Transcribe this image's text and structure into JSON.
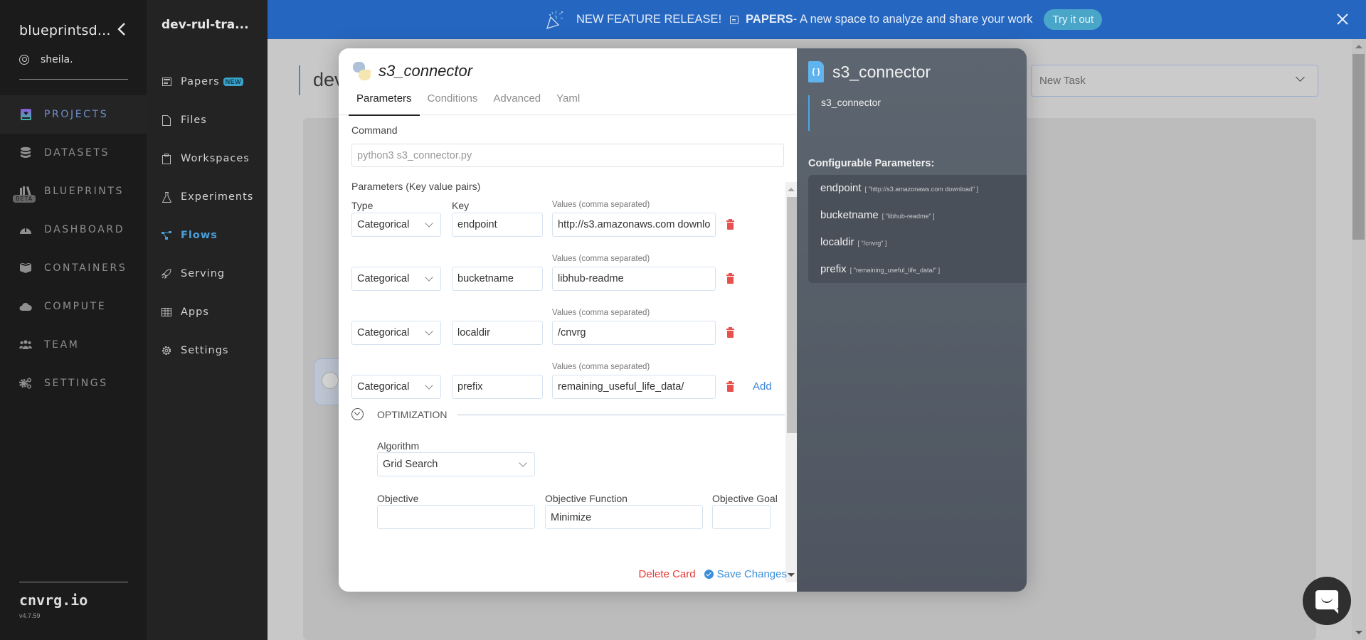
{
  "sidebar": {
    "org_name": "blueprintsd...",
    "user_name": "sheila.",
    "items": [
      {
        "label": "PROJECTS",
        "icon": "projects-icon",
        "active": true
      },
      {
        "label": "DATASETS",
        "icon": "database-icon",
        "active": false
      },
      {
        "label": "BLUEPRINTS",
        "icon": "books-icon",
        "active": false,
        "badge": "BETA"
      },
      {
        "label": "DASHBOARD",
        "icon": "gauge-icon",
        "active": false
      },
      {
        "label": "CONTAINERS",
        "icon": "box-icon",
        "active": false
      },
      {
        "label": "COMPUTE",
        "icon": "cloud-icon",
        "active": false
      },
      {
        "label": "TEAM",
        "icon": "users-icon",
        "active": false
      },
      {
        "label": "SETTINGS",
        "icon": "gears-icon",
        "active": false
      }
    ],
    "brand": "cnvrg.io",
    "version": "v4.7.59"
  },
  "project_nav": {
    "project_name": "dev-rul-tra...",
    "items": [
      {
        "label": "Papers",
        "icon": "papers-icon",
        "badge": "NEW"
      },
      {
        "label": "Files",
        "icon": "file-icon"
      },
      {
        "label": "Workspaces",
        "icon": "clipboard-icon"
      },
      {
        "label": "Experiments",
        "icon": "flask-icon"
      },
      {
        "label": "Flows",
        "icon": "flows-icon",
        "active": true
      },
      {
        "label": "Serving",
        "icon": "rocket-icon"
      },
      {
        "label": "Apps",
        "icon": "grid-icon"
      },
      {
        "label": "Settings",
        "icon": "gear-icon"
      }
    ]
  },
  "banner": {
    "headline": "NEW FEATURE RELEASE!",
    "product": "PAPERS",
    "description": " - A new space to analyze and share your work",
    "cta": "Try it out",
    "close": "✕",
    "color": "#2566c0"
  },
  "page": {
    "title_fragment": "dev",
    "task_select": "New Task"
  },
  "modal": {
    "title": "s3_connector",
    "tabs": [
      "Parameters",
      "Conditions",
      "Advanced",
      "Yaml"
    ],
    "active_tab": "Parameters",
    "command_label": "Command",
    "command_placeholder": "python3 s3_connector.py",
    "params_label": "Parameters (Key value pairs)",
    "type_header": "Type",
    "key_header": "Key",
    "values_header": "Values (comma separated)",
    "params": [
      {
        "type": "Categorical",
        "key": "endpoint",
        "value": "http://s3.amazonaws.com downlo"
      },
      {
        "type": "Categorical",
        "key": "bucketname",
        "value": "libhub-readme"
      },
      {
        "type": "Categorical",
        "key": "localdir",
        "value": "/cnvrg"
      },
      {
        "type": "Categorical",
        "key": "prefix",
        "value": "remaining_useful_life_data/"
      }
    ],
    "add_label": "Add",
    "optimization": {
      "title": "OPTIMIZATION",
      "algorithm_label": "Algorithm",
      "algorithm_value": "Grid Search",
      "objective_label": "Objective",
      "objective_value": "",
      "objective_function_label": "Objective Function",
      "objective_function_value": "Minimize",
      "objective_goal_label": "Objective Goal",
      "objective_goal_value": ""
    },
    "delete_label": "Delete Card",
    "save_label": "Save Changes"
  },
  "summary": {
    "title": "s3_connector",
    "description": "s3_connector",
    "configurable_label": "Configurable Parameters:",
    "params": [
      {
        "key": "endpoint",
        "value": "[ \"http://s3.amazonaws.com download\" ]"
      },
      {
        "key": "bucketname",
        "value": "[ \"libhub-readme\" ]"
      },
      {
        "key": "localdir",
        "value": "[ \"/cnvrg\" ]"
      },
      {
        "key": "prefix",
        "value": "[ \"remaining_useful_life_data/\" ]"
      }
    ]
  }
}
